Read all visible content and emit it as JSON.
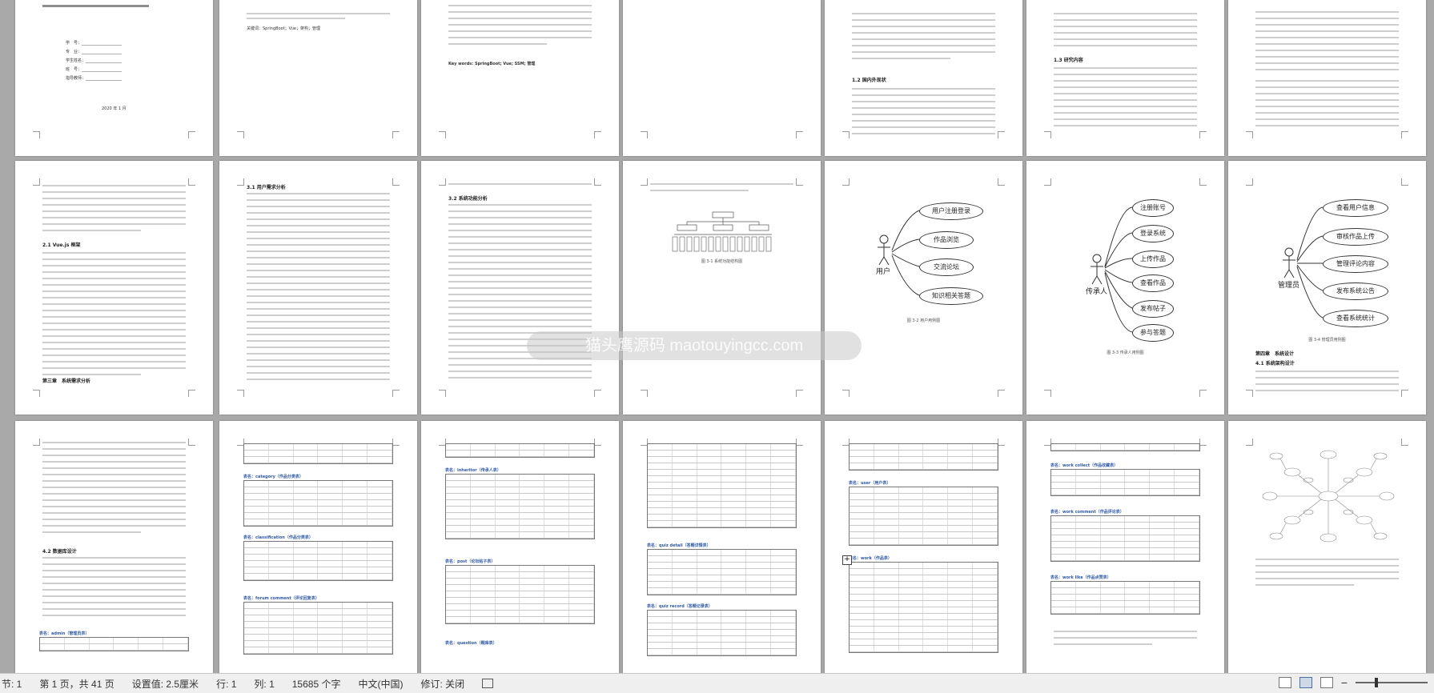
{
  "document": {
    "cover_fields": [
      "学　号：",
      "专　业：",
      "学生姓名：",
      "班　号：",
      "指导教师："
    ],
    "date": "2020 年 1 月",
    "keywords_cn": "关键词：SpringBoot；Vue；架构；管理",
    "keywords_en": "Key words: SpringBoot; Vue; SSM; 管理",
    "headings": {
      "h21": "2.1 Vue.js 框架",
      "ch3": "第三章　系统需求分析",
      "h31": "3.1 用户需求分析",
      "h32": "3.2 系统功能分析",
      "h12": "1.2 国内外现状",
      "h13": "1.3 研究内容",
      "ch4": "第四章　系统设计",
      "h41": "4.1 系统架构设计",
      "h42": "4.2 数据库设计"
    },
    "captions": {
      "structure": "图 3-1 系统功能结构图",
      "user_uc": "图 3-2 用户用例图",
      "uploader_uc": "图 3-3 传承人用例图",
      "admin_uc": "图 3-4 管理员用例图"
    },
    "user_usecase": {
      "actor": "用户",
      "cases": [
        "用户注册登录",
        "作品浏览",
        "交流论坛",
        "知识相关答题"
      ]
    },
    "uploader_usecase": {
      "actor": "传承人",
      "cases": [
        "注册账号",
        "登录系统",
        "上传作品",
        "查看作品",
        "发布帖子",
        "参与答题"
      ]
    },
    "admin_usecase": {
      "actor": "管理员",
      "cases": [
        "查看用户信息",
        "审核作品上传",
        "管理评论内容",
        "发布系统公告",
        "查看系统统计"
      ]
    },
    "tables": [
      "表名：category（作品分类表）",
      "表名：classification（作品分类表）",
      "表名：forum comment（评论回复表）",
      "表名：admin（管理员表）",
      "表名：inheritor（传承人表）",
      "表名：post（论坛帖子表）",
      "表名：question（题库表）",
      "表名：quiz detail（答题详情表）",
      "表名：quiz record（答题记录表）",
      "表名：user（用户表）",
      "表名：work（作品表）",
      "表名：work collect（作品收藏表）",
      "表名：work comment（作品评论表）",
      "表名：work like（作品点赞表）"
    ]
  },
  "watermark": "猫头鹰源码 maotouyingcc.com",
  "statusbar": {
    "section": "节: 1",
    "page": "第 1 页，共 41 页",
    "setting": "设置值: 2.5厘米",
    "row": "行: 1",
    "col": "列: 1",
    "word_count": "15685 个字",
    "language": "中文(中国)",
    "revision": "修订: 关闭"
  },
  "colors": {
    "background": "#a9a9a9",
    "page": "#ffffff",
    "table_title": "#2f5aa8",
    "statusbar": "#efefef"
  }
}
